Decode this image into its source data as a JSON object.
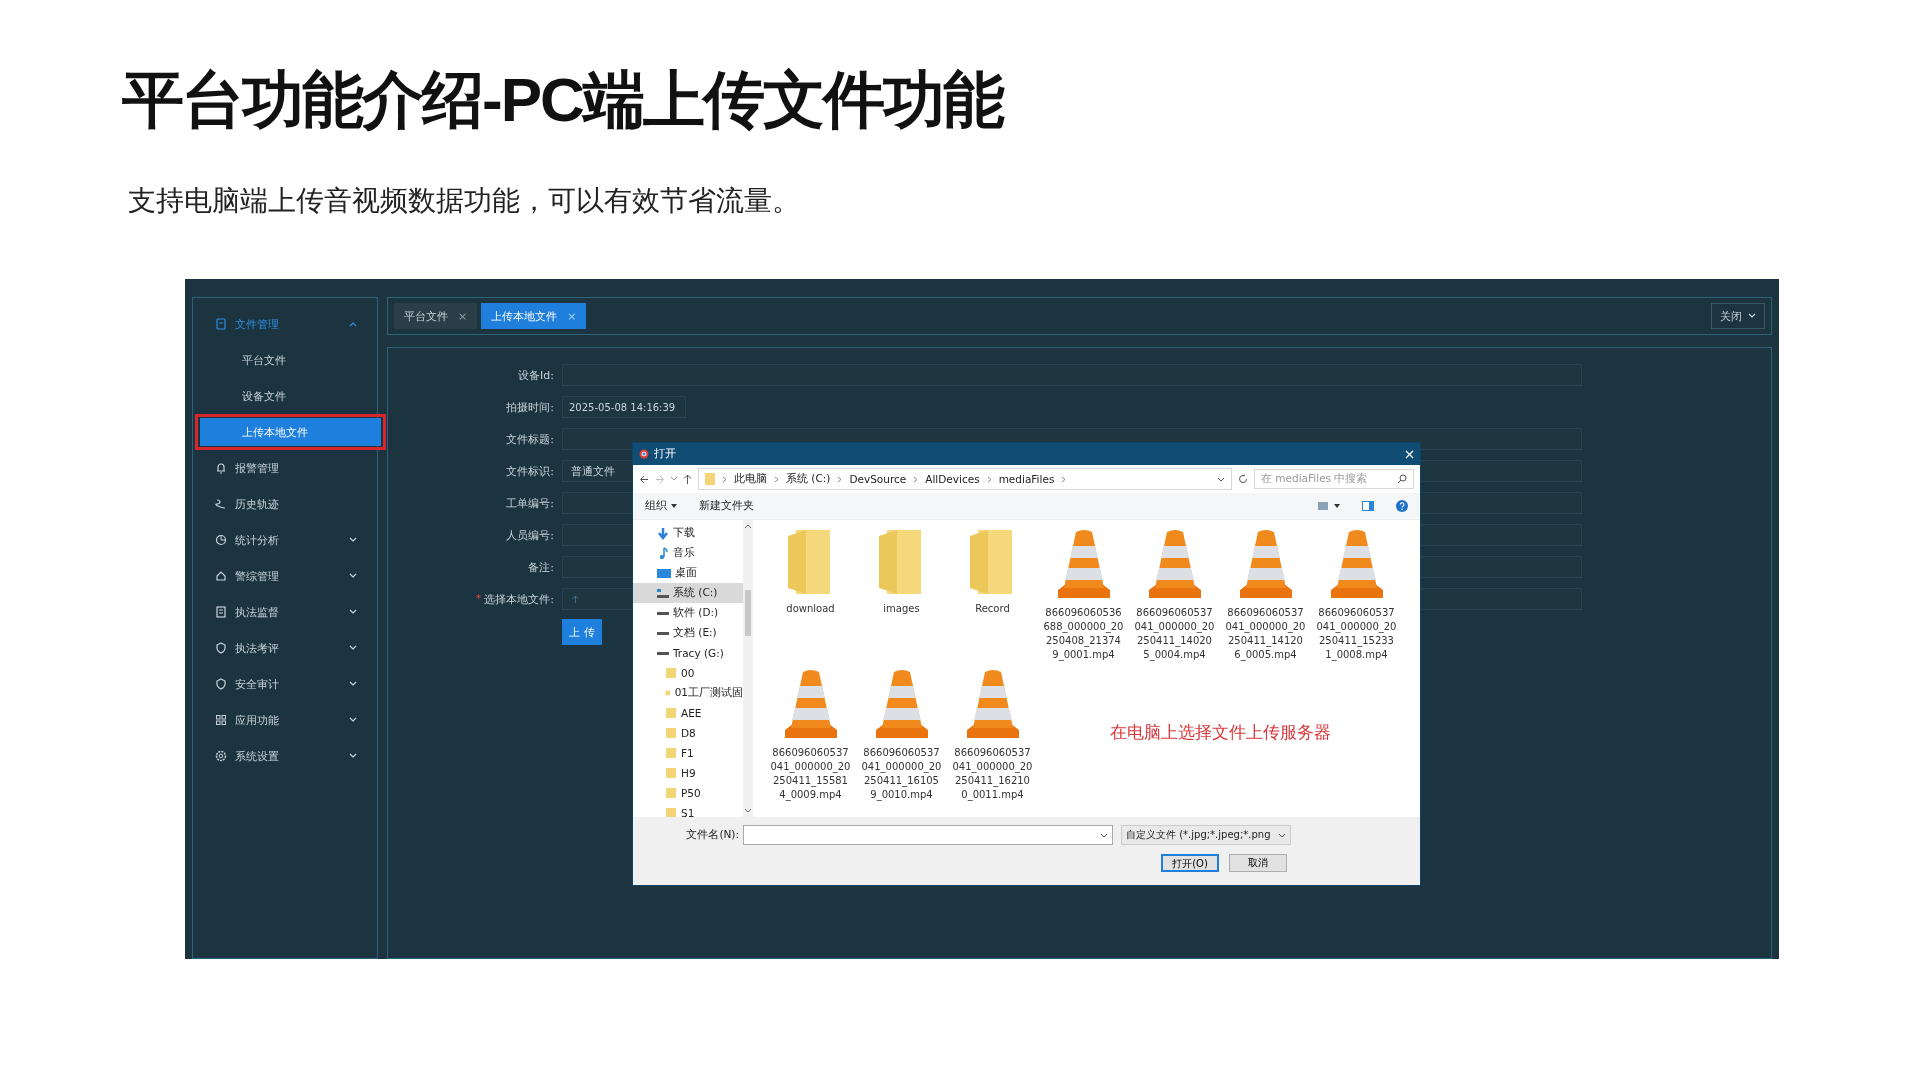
{
  "title": "平台功能介绍-PC端上传文件功能",
  "subtitle": "支持电脑端上传音视频数据功能，可以有效节省流量。",
  "app": {
    "sidebar": [
      {
        "label": "文件管理",
        "expanded": true,
        "children": [
          {
            "label": "平台文件",
            "selected": false,
            "highlighted": false
          },
          {
            "label": "设备文件",
            "selected": false,
            "highlighted": false
          },
          {
            "label": "上传本地文件",
            "selected": true,
            "highlighted": true
          }
        ]
      },
      {
        "label": "报警管理"
      },
      {
        "label": "历史轨迹"
      },
      {
        "label": "统计分析",
        "expanded": false
      },
      {
        "label": "警综管理",
        "expanded": false
      },
      {
        "label": "执法监督",
        "expanded": false
      },
      {
        "label": "执法考评",
        "expanded": false
      },
      {
        "label": "安全审计",
        "expanded": false
      },
      {
        "label": "应用功能",
        "expanded": false
      },
      {
        "label": "系统设置",
        "expanded": false
      }
    ],
    "tabs": [
      {
        "label": "平台文件",
        "close": "×",
        "selected": false
      },
      {
        "label": "上传本地文件",
        "close": "×",
        "selected": true
      }
    ],
    "close_menu": "关闭",
    "form": [
      {
        "label": "设备Id:",
        "kind": "text"
      },
      {
        "label": "拍摄时间:",
        "kind": "date",
        "value": "2025-05-08 14:16:39"
      },
      {
        "label": "文件标题:",
        "kind": "text"
      },
      {
        "label": "文件标识:",
        "kind": "select",
        "value": "普通文件"
      },
      {
        "label": "工单编号:",
        "kind": "text"
      },
      {
        "label": "人员编号:",
        "kind": "text"
      },
      {
        "label": "备注:",
        "kind": "text"
      },
      {
        "label": "选择本地文件:",
        "kind": "file",
        "required_mark": "*"
      }
    ],
    "upload_button": "上 传",
    "dialog": {
      "title": "打开",
      "breadcrumb": [
        "此电脑",
        "系统 (C:)",
        "DevSource",
        "AllDevices",
        "mediaFiles"
      ],
      "search_placeholder": "在 mediaFiles 中搜索",
      "toolbar": [
        "组织",
        "新建文件夹"
      ],
      "nav": [
        {
          "label": "下载",
          "kind": "download",
          "selected": false
        },
        {
          "label": "音乐",
          "kind": "music",
          "selected": false
        },
        {
          "label": "桌面",
          "kind": "desktop",
          "selected": false
        },
        {
          "label": "系统 (C:)",
          "kind": "system-drive",
          "selected": true
        },
        {
          "label": "软件 (D:)",
          "kind": "drive",
          "selected": false
        },
        {
          "label": "文档 (E:)",
          "kind": "drive",
          "selected": false
        },
        {
          "label": "Tracy (G:)",
          "kind": "drive",
          "selected": false
        },
        {
          "label": "00",
          "kind": "folder",
          "selected": false
        },
        {
          "label": "01工厂测试固",
          "kind": "folder",
          "selected": false
        },
        {
          "label": "AEE",
          "kind": "folder",
          "selected": false
        },
        {
          "label": "D8",
          "kind": "folder",
          "selected": false
        },
        {
          "label": "F1",
          "kind": "folder",
          "selected": false
        },
        {
          "label": "H9",
          "kind": "folder",
          "selected": false
        },
        {
          "label": "P50",
          "kind": "folder",
          "selected": false
        },
        {
          "label": "S1",
          "kind": "folder",
          "selected": false
        }
      ],
      "files": [
        {
          "name": "download",
          "kind": "folder"
        },
        {
          "name": "images",
          "kind": "folder"
        },
        {
          "name": "Record",
          "kind": "folder"
        },
        {
          "name": "866096060536688_000000_20250408_213749_0001.mp4",
          "kind": "video"
        },
        {
          "name": "866096060537041_000000_20250411_140205_0004.mp4",
          "kind": "video"
        },
        {
          "name": "866096060537041_000000_20250411_141206_0005.mp4",
          "kind": "video"
        },
        {
          "name": "866096060537041_000000_20250411_152331_0008.mp4",
          "kind": "video"
        },
        {
          "name": "866096060537041_000000_20250411_155814_0009.mp4",
          "kind": "video"
        },
        {
          "name": "866096060537041_000000_20250411_161059_0010.mp4",
          "kind": "video"
        },
        {
          "name": "866096060537041_000000_20250411_162100_0011.mp4",
          "kind": "video"
        }
      ],
      "annotation": "在电脑上选择文件上传服务器",
      "filename_label": "文件名(N):",
      "filter": "自定义文件 (*.jpg;*.jpeg;*.png",
      "buttons": [
        {
          "label": "打开(O)",
          "default": true
        },
        {
          "label": "取消",
          "default": false
        }
      ]
    }
  }
}
